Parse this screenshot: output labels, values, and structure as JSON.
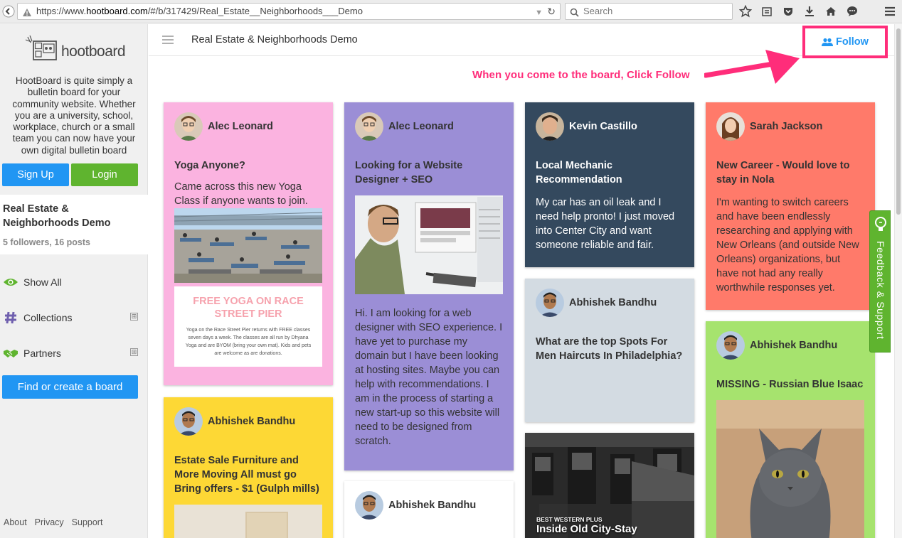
{
  "browser": {
    "url_prefix": "https://www.",
    "url_domain": "hootboard.com",
    "url_path": "/#/b/317429/Real_Estate__Neighborhoods___Demo",
    "search_placeholder": "Search"
  },
  "sidebar": {
    "logo_text": "hootboard",
    "description": "HootBoard is quite simply a bulletin board for your community website. Whether you are a university, school, workplace, church or a small team you can now have your own digital bulletin board",
    "signup_label": "Sign Up",
    "login_label": "Login",
    "board_name": "Real Estate & Neighborhoods Demo",
    "board_stats": "5 followers, 16 posts",
    "nav": [
      {
        "label": "Show All",
        "icon": "eye-icon"
      },
      {
        "label": "Collections",
        "icon": "hashtag-icon",
        "expand": "⊞"
      },
      {
        "label": "Partners",
        "icon": "handshake-icon",
        "expand": "⊞"
      }
    ],
    "find_label": "Find or create a board",
    "footer": [
      "About",
      "Privacy",
      "Support"
    ]
  },
  "header": {
    "title": "Real Estate & Neighborhoods Demo",
    "follow_label": "Follow"
  },
  "annotation": "When you come to the board, Click Follow",
  "feedback_label": "Feedback & Support",
  "colors": {
    "blue": "#2196f3",
    "green": "#5fb42f",
    "pink_card": "#fbb3e0",
    "purple_card": "#9b8ed6",
    "navy_card": "#34495e",
    "grey_card": "#d3dbe2",
    "coral_card": "#ff7a6a",
    "lime_card": "#a6e36e",
    "yellow_card": "#fdd835",
    "annotation": "#ff2d7a"
  },
  "cards": {
    "yoga": {
      "author": "Alec Leonard",
      "title": "Yoga Anyone?",
      "body": "Came across this new Yoga Class if anyone wants to join.",
      "poster_head": "FREE YOGA ON RACE STREET PIER",
      "poster_small": "Yoga on the Race Street Pier returns with FREE classes seven days a week. The classes are all run by Dhyana Yoga and are BYOM (bring your own mat). Kids and pets are welcome as are donations."
    },
    "web": {
      "author": "Alec Leonard",
      "title": "Looking for a Website Designer + SEO",
      "body": "Hi. I am looking for a web designer with SEO experience. I have yet to purchase my domain but I have been looking at hosting sites. Maybe you can help with recommendations. I am in the process of starting a new start-up so this website will need to be designed from scratch."
    },
    "mechanic": {
      "author": "Kevin Castillo",
      "title": "Local Mechanic Recommendation",
      "body": "My car has an oil leak and I need help pronto!  I just moved into Center City and want someone reliable and fair."
    },
    "career": {
      "author": "Sarah Jackson",
      "title": "New Career - Would love to stay in Nola",
      "body": "I'm wanting to switch careers and have been endlessly researching and applying with New Orleans (and outside New Orleans) organizations, but have not had any really worthwhile responses yet."
    },
    "haircut": {
      "author": "Abhishek Bandhu",
      "title": "What are the top Spots For Men Haircuts In Philadelphia?"
    },
    "cat": {
      "author": "Abhishek Bandhu",
      "title": "MISSING - Russian Blue Isaac"
    },
    "estate": {
      "author": "Abhishek Bandhu",
      "title": "Estate Sale Furniture and More Moving All must go Bring offers - $1 (Gulph mills)"
    },
    "abhishek_white": {
      "author": "Abhishek Bandhu"
    },
    "hotel": {
      "overlay_small": "BEST WESTERN PLUS",
      "overlay_big": "Inside Old City-Stay"
    }
  }
}
